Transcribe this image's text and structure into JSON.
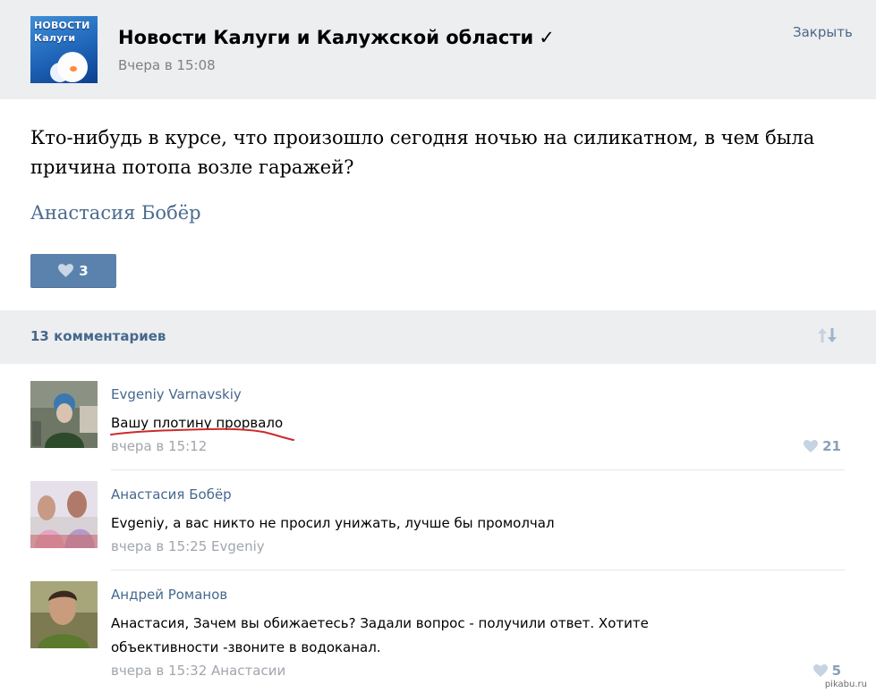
{
  "post": {
    "group_name": "Новости Калуги и Калужской области",
    "verified_mark": "✓",
    "time": "Вчера в 15:08",
    "close_label": "Закрыть",
    "avatar_text_line1": "НОВОСТИ",
    "avatar_text_line2": "Калуги",
    "text": "Кто-нибудь в курсе, что произошло сегодня ночью на силикатном, в чем была причина потопа возле гаражей?",
    "author": "Анастасия Бобёр",
    "likes": "3"
  },
  "comments_header": {
    "count_label": "13 комментариев"
  },
  "comments": [
    {
      "name": "Evgeniy Varnavskiy",
      "text": "Вашу плотину прорвало",
      "meta": "вчера в 15:12",
      "likes": "21"
    },
    {
      "name": "Анастасия Бобёр",
      "text": "Evgeniy, а вас никто не просил унижать, лучше бы промолчал",
      "meta": "вчера в 15:25 Evgeniy",
      "likes": ""
    },
    {
      "name": "Андрей Романов",
      "text": "Анастасия, Зачем вы обижаетесь? Задали вопрос - получили ответ. Хотите объективности -звоните в водоканал.",
      "meta": "вчера в 15:32 Анастасии",
      "likes": "5"
    }
  ],
  "watermark": "pikabu.ru",
  "colors": {
    "header_bg": "#edeef0",
    "link": "#45688e",
    "like_button": "#5b82ad",
    "underline": "#cc2a2a"
  }
}
